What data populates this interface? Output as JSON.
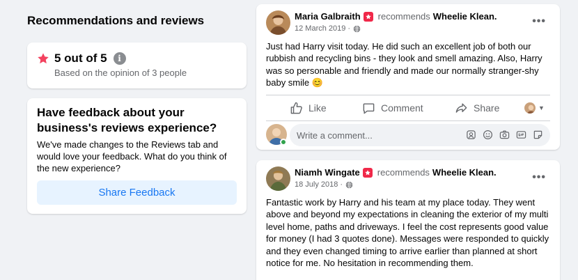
{
  "left": {
    "title": "Recommendations and reviews",
    "rating": {
      "value_text": "5 out of 5",
      "sub_text": "Based on the opinion of 3 people",
      "info_glyph": "i",
      "star_color": "#f3425f"
    },
    "feedback": {
      "title": "Have feedback about your business's reviews experience?",
      "body": "We've made changes to the Reviews tab and would love your feedback. What do you think of the new experience?",
      "button_label": "Share Feedback"
    }
  },
  "posts": [
    {
      "author": "Maria Galbraith",
      "verb": "recommends",
      "business": "Wheelie Klean.",
      "date": "12 March 2019 ·",
      "text": "Just had Harry visit today. He did such an excellent job of both our rubbish and recycling bins - they look and smell amazing. Also, Harry was so personable and friendly and made our normally stranger-shy baby smile 😊",
      "actions": {
        "like": "Like",
        "comment": "Comment",
        "share": "Share"
      },
      "comment_placeholder": "Write a comment..."
    },
    {
      "author": "Niamh Wingate",
      "verb": "recommends",
      "business": "Wheelie Klean.",
      "date": "18 July 2018 ·",
      "text": "Fantastic work by Harry and his team at my place today. They went above and beyond my expectations in cleaning the exterior of my multi level home, paths and driveways. I feel the cost represents good value for money (I had 3 quotes done). Messages were responded to quickly and they even changed timing to arrive earlier than planned at short notice for me. No hesitation in recommending them."
    }
  ],
  "more_glyph": "•••",
  "caret_glyph": "▼",
  "colors": {
    "accent": "#1877f2",
    "recommend_badge": "#f02849",
    "online": "#31a24c"
  }
}
